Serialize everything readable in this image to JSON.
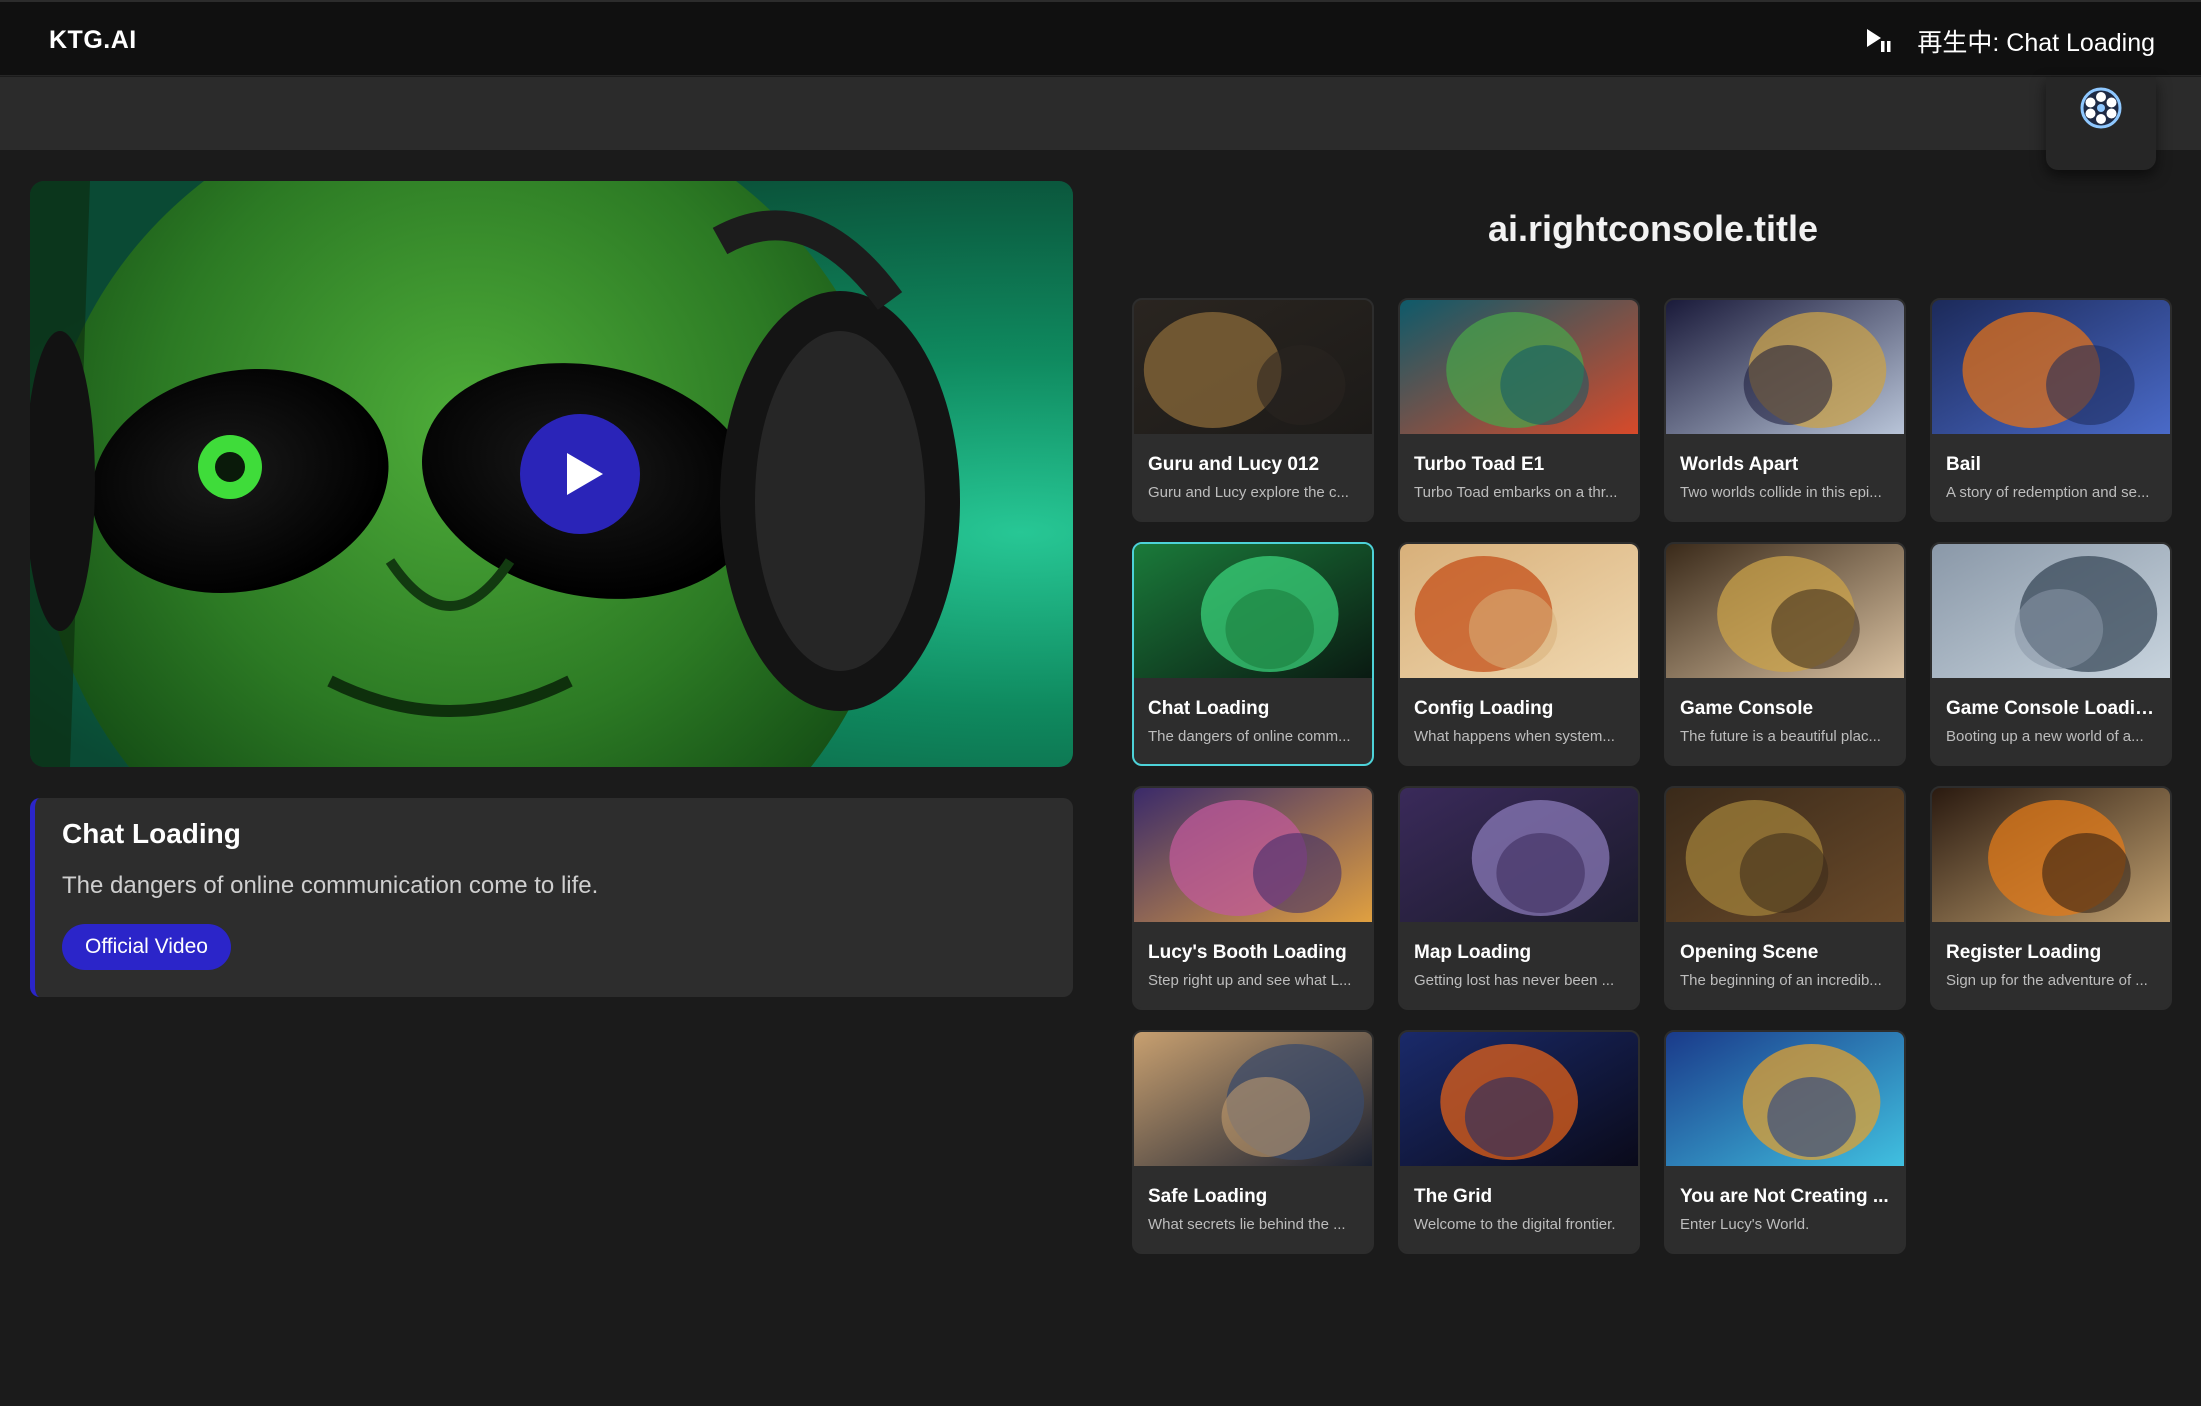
{
  "app": {
    "brand": "KTG.AI"
  },
  "now_playing": {
    "icon": "play-pause-icon",
    "text": "再生中: Chat Loading"
  },
  "settings": {
    "icon": "film-reel-icon"
  },
  "player": {
    "play_icon": "play-icon",
    "title": "Chat Loading",
    "description": "The dangers of online communication come to life.",
    "button_label": "Official Video"
  },
  "grid": {
    "title": "ai.rightconsole.title",
    "videos": [
      {
        "title": "Guru and Lucy 012",
        "description": "Guru and Lucy explore the c...",
        "thumb": [
          "#2a2520",
          "#8a6a3a",
          "#1c1a18"
        ],
        "active": false
      },
      {
        "title": "Turbo Toad E1",
        "description": "Turbo Toad embarks on a thr...",
        "thumb": [
          "#0e5a6a",
          "#4aa24a",
          "#d84a2a"
        ],
        "active": false
      },
      {
        "title": "Worlds Apart",
        "description": "Two worlds collide in this epi...",
        "thumb": [
          "#1a1a3a",
          "#c9a24a",
          "#b8c4d8"
        ],
        "active": false
      },
      {
        "title": "Bail",
        "description": "A story of redemption and se...",
        "thumb": [
          "#1c2a5a",
          "#e0701a",
          "#4a6ac8"
        ],
        "active": false
      },
      {
        "title": "Chat Loading",
        "description": "The dangers of online comm...",
        "thumb": [
          "#1a7a3a",
          "#3ad07a",
          "#0a1a12"
        ],
        "active": true
      },
      {
        "title": "Config Loading",
        "description": "What happens when system...",
        "thumb": [
          "#d8b07a",
          "#c4501a",
          "#f0d8b0"
        ],
        "active": false
      },
      {
        "title": "Game Console",
        "description": "The future is a beautiful plac...",
        "thumb": [
          "#3a2a1a",
          "#c9a24a",
          "#d8c0a0"
        ],
        "active": false
      },
      {
        "title": "Game Console Loading",
        "description": "Booting up a new world of a...",
        "thumb": [
          "#8a98a8",
          "#3a4a5a",
          "#c8d4de"
        ],
        "active": false
      },
      {
        "title": "Lucy's Booth Loading",
        "description": "Step right up and see what L...",
        "thumb": [
          "#3a2a6a",
          "#c05a9a",
          "#e0a040"
        ],
        "active": false
      },
      {
        "title": "Map Loading",
        "description": "Getting lost has never been ...",
        "thumb": [
          "#3a2a5a",
          "#8a7ab8",
          "#1a1a2a"
        ],
        "active": false
      },
      {
        "title": "Opening Scene",
        "description": "The beginning of an incredib...",
        "thumb": [
          "#3a2a1a",
          "#a0803a",
          "#6a4a2a"
        ],
        "active": false
      },
      {
        "title": "Register Loading",
        "description": "Sign up for the adventure of ...",
        "thumb": [
          "#2a1a10",
          "#e07a1a",
          "#c0a070"
        ],
        "active": false
      },
      {
        "title": "Safe Loading",
        "description": "What secrets lie behind the ...",
        "thumb": [
          "#c8a070",
          "#3a4a6a",
          "#1a2030"
        ],
        "active": false
      },
      {
        "title": "The Grid",
        "description": "Welcome to the digital frontier.",
        "thumb": [
          "#1a2a6a",
          "#e0601a",
          "#0a0a1a"
        ],
        "active": false
      },
      {
        "title": "You are Not Creating ...",
        "description": "Enter Lucy's World.",
        "thumb": [
          "#1a3a8a",
          "#e0a030",
          "#40c0e0"
        ],
        "active": false
      }
    ]
  }
}
